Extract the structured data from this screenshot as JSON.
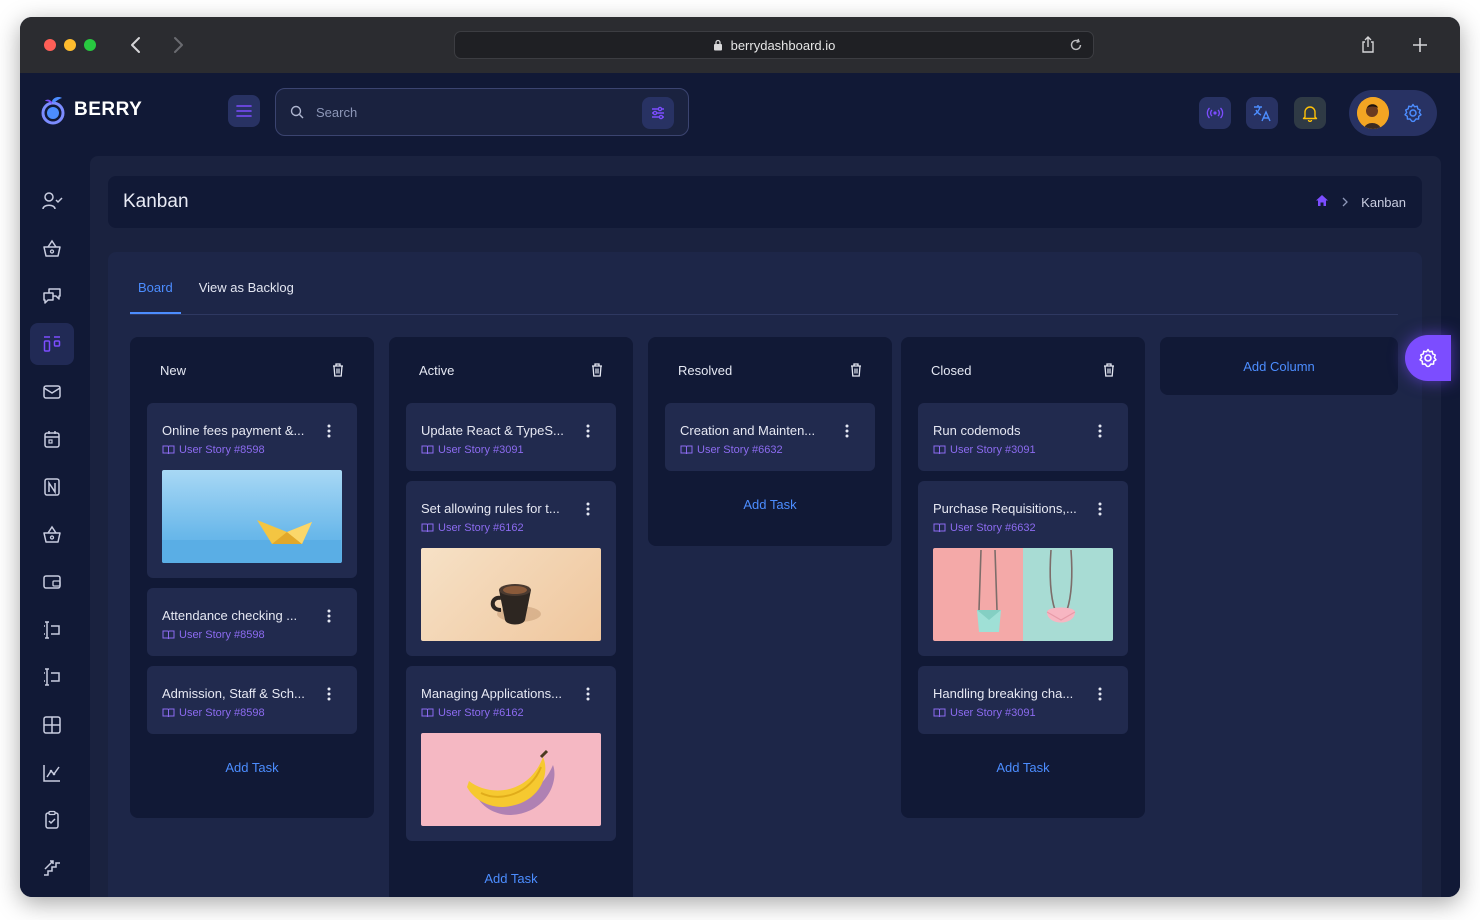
{
  "browser": {
    "url": "berrydashboard.io"
  },
  "header": {
    "brand": "BERRY",
    "search_placeholder": "Search"
  },
  "page": {
    "title": "Kanban",
    "breadcrumb_current": "Kanban"
  },
  "tabs": [
    {
      "label": "Board",
      "active": true
    },
    {
      "label": "View as Backlog",
      "active": false
    }
  ],
  "columns": [
    {
      "title": "New",
      "add_task": "Add Task",
      "cards": [
        {
          "title": "Online fees payment &...",
          "story": "User Story #8598",
          "image": "paper-boat"
        },
        {
          "title": "Attendance checking ...",
          "story": "User Story #8598"
        },
        {
          "title": "Admission, Staff & Sch...",
          "story": "User Story #8598"
        }
      ]
    },
    {
      "title": "Active",
      "add_task": "Add Task",
      "cards": [
        {
          "title": "Update React & TypeS...",
          "story": "User Story #3091"
        },
        {
          "title": "Set allowing rules for t...",
          "story": "User Story #6162",
          "image": "coffee-mug"
        },
        {
          "title": "Managing Applications...",
          "story": "User Story #6162",
          "image": "banana"
        }
      ]
    },
    {
      "title": "Resolved",
      "add_task": "Add Task",
      "cards": [
        {
          "title": "Creation and Mainten...",
          "story": "User Story #6632"
        }
      ]
    },
    {
      "title": "Closed",
      "add_task": "Add Task",
      "cards": [
        {
          "title": "Run codemods",
          "story": "User Story #3091"
        },
        {
          "title": "Purchase Requisitions,...",
          "story": "User Story #6632",
          "image": "handbags"
        },
        {
          "title": "Handling breaking cha...",
          "story": "User Story #3091"
        }
      ]
    }
  ],
  "add_column_label": "Add Column",
  "colors": {
    "accent": "#4c8dff",
    "purple": "#7c4dff",
    "story": "#8c6bf0",
    "background": "#111936",
    "panel": "#1a223f",
    "card": "#212a4e"
  }
}
